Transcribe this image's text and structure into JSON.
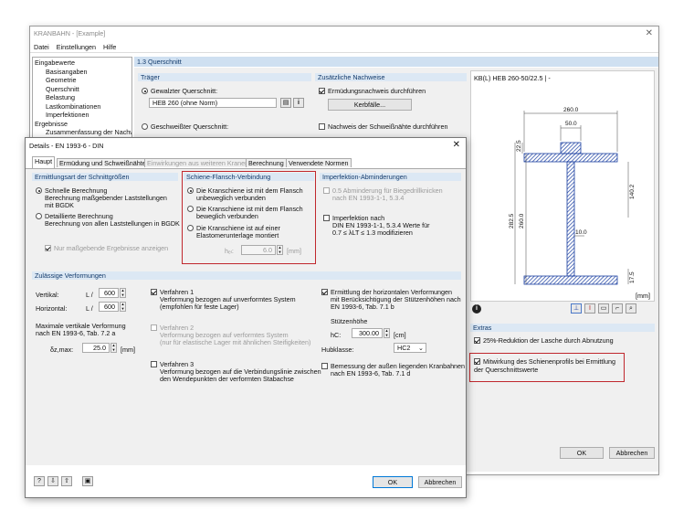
{
  "app": {
    "title": "KRANBAHN - [Example]",
    "menu": [
      "Datei",
      "Einstellungen",
      "Hilfe"
    ]
  },
  "tree": [
    "Eingabewerte",
    "Basisangaben",
    "Geometrie",
    "Querschnitt",
    "Belastung",
    "Lastkombinationen",
    "Imperfektionen",
    "Ergebnisse",
    "Zusammenfassung der Nachwe"
  ],
  "section": {
    "title": "1.3 Querschnitt"
  },
  "traeger": {
    "title": "Träger",
    "gewalzter": "Gewalzter Querschnitt:",
    "profile": "HEB 260 (ohne Norm)",
    "geschweisster": "Geschweißter Querschnitt:"
  },
  "zusatz": {
    "title": "Zusätzliche Nachweise",
    "ermuedung": "Ermüdungsnachweis durchführen",
    "kerbfall": "Kerbfälle...",
    "schweiss": "Nachweis der Schweißnähte durchführen"
  },
  "drawing": {
    "title": "KB(L) HEB 260-50/22.5 | -",
    "dims": [
      "260.0",
      "50.0",
      "22.5",
      "140.2",
      "282.5",
      "260.0",
      "10.0",
      "17.5"
    ],
    "unit": "[mm]"
  },
  "extras": {
    "title": "Extras",
    "opt1": "25%-Reduktion der Lasche durch Abnutzung",
    "opt2": "Mitwirkung des Schienenprofils bei Ermittlung der Querschnittswerte"
  },
  "main_buttons": {
    "ok": "OK",
    "cancel": "Abbrechen"
  },
  "dialog": {
    "title": "Details - EN 1993-6 - DIN",
    "tabs": [
      "Haupt",
      "Ermüdung und Schweißnähte",
      "Einwirkungen aus weiteren Kranen",
      "Berechnung",
      "Verwendete Normen"
    ],
    "ermittlung": {
      "title": "Ermittlungsart der Schnittgrößen",
      "r1a": "Schnelle Berechnung",
      "r1b": "Berechnung maßgebender Laststellungen",
      "r1c": "mit BGDK",
      "r2a": "Detaillierte Berechnung",
      "r2b": "Berechnung von allen Laststellungen in BGDK",
      "cb": "Nur maßgebende Ergebnisse anzeigen"
    },
    "schiene": {
      "title": "Schiene-Flansch-Verbindung",
      "r1a": "Die Kranschiene ist mit dem Flansch",
      "r1b": "unbeweglich verbunden",
      "r2a": "Die Kranschiene ist mit dem Flansch",
      "r2b": "beweglich verbunden",
      "r3a": "Die Kranschiene ist auf einer",
      "r3b": "Elastomerunterlage montiert",
      "h_label": "hₑₗ:",
      "h_value": "6.0",
      "h_unit": "[mm]"
    },
    "imperf": {
      "title": "Imperfektion-Abminderungen",
      "c1a": "0.5 Abminderung für Biegedrillknicken",
      "c1b": "nach EN 1993-1-1, 5.3.4",
      "c2a": "Imperfektion nach",
      "c2b": "DIN EN 1993-1-1, 5.3.4 Werte für",
      "c2c": "0.7 ≤ λLT ≤ 1.3 modifizieren"
    },
    "verf": {
      "title": "Zulässige Verformungen",
      "vertikal": "Vertikal:",
      "horizontal": "Horizontal:",
      "l_sym": "L /",
      "v_val": "600",
      "h_val": "600",
      "max1": "Maximale vertikale Verformung",
      "max2": "nach EN 1993-6, Tab. 7.2 a",
      "dz": "δz,max:",
      "dz_val": "25.0",
      "dz_unit": "[mm]",
      "v1a": "Verfahren 1",
      "v1b": "Verformung bezogen auf unverformtes System",
      "v1c": "(empfohlen für feste Lager)",
      "v2a": "Verfahren 2",
      "v2b": "Verformung bezogen auf verformtes System",
      "v2c": "(nur für elastische Lager mit ähnlichen Steifigkeiten)",
      "v3a": "Verfahren 3",
      "v3b": "Verformung bezogen auf die Verbindungslinie zwischen",
      "v3c": "den Wendepunkten der verformten Stabachse",
      "e1a": "Ermittlung der horizontalen Verformungen",
      "e1b": "mit Berücksichtigung der Stützenhöhen nach",
      "e1c": "EN 1993-6, Tab. 7.1 b",
      "stuetz": "Stützenhöhe",
      "hc": "hC:",
      "hc_val": "300.00",
      "hc_unit": "[cm]",
      "hub": "Hubklasse:",
      "hub_val": "HC2",
      "b1a": "Bemessung der außen liegenden Kranbahnen",
      "b1b": "nach EN 1993-6, Tab. 7.1 d"
    },
    "ok": "OK",
    "cancel": "Abbrechen"
  }
}
